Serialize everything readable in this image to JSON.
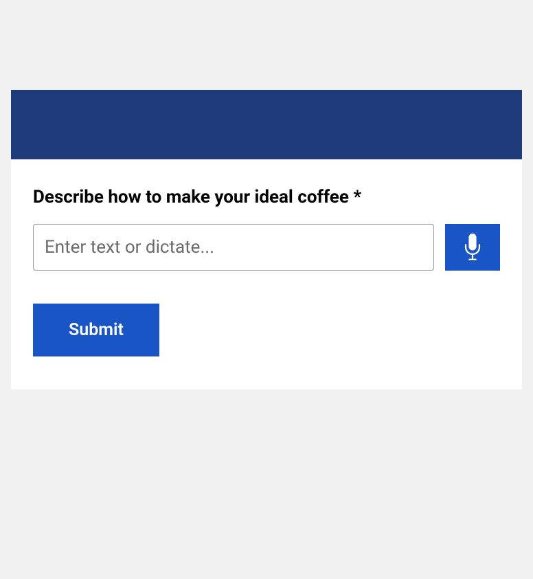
{
  "form": {
    "label": "Describe how to make your ideal coffee *",
    "input": {
      "placeholder": "Enter text or dictate...",
      "value": ""
    },
    "submit_label": "Submit"
  }
}
